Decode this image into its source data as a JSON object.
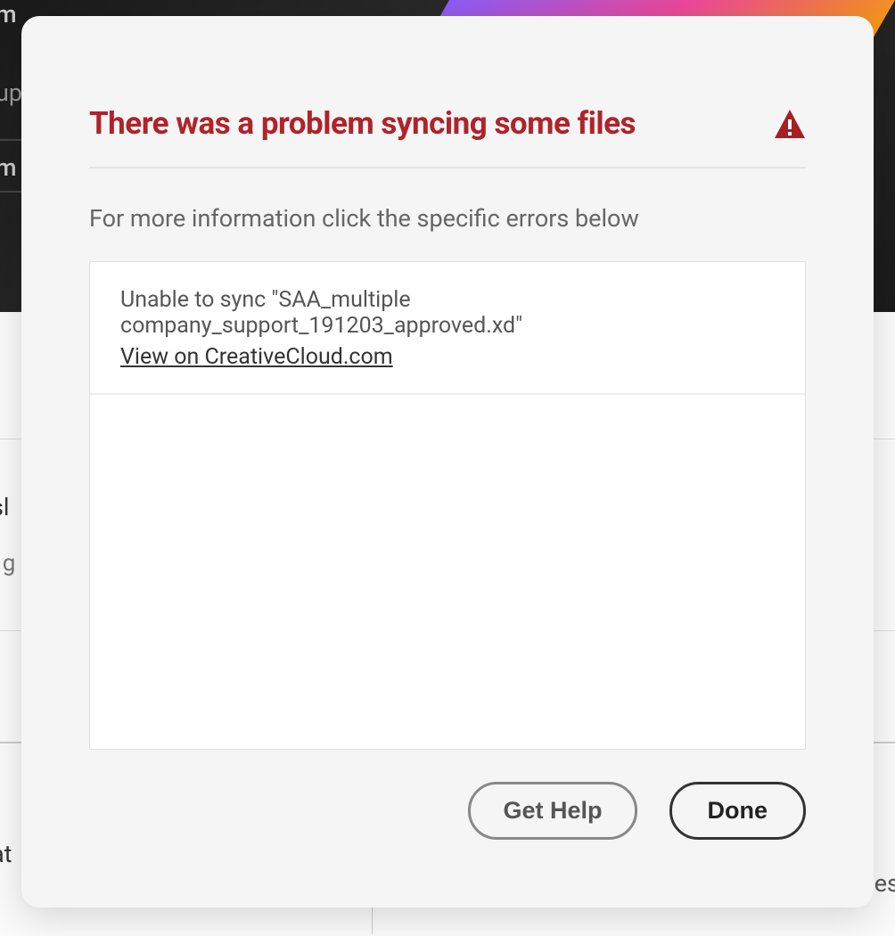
{
  "dialog": {
    "title": "There was a problem syncing some files",
    "subtitle": "For more information click the specific errors below",
    "errors": [
      {
        "message": "Unable to sync \"SAA_multiple company_support_191203_approved.xd\"",
        "link_text": "View on CreativeCloud.com"
      }
    ],
    "get_help_label": "Get Help",
    "done_label": "Done"
  },
  "background": {
    "text_1": "m",
    "text_2": "up",
    "text_3": "m",
    "row_1_text": "sl",
    "row_1_sub": "l g",
    "row_3_text": "at",
    "right_text": "es"
  },
  "colors": {
    "error_red": "#b0232a",
    "warning_red": "#a91e22"
  }
}
